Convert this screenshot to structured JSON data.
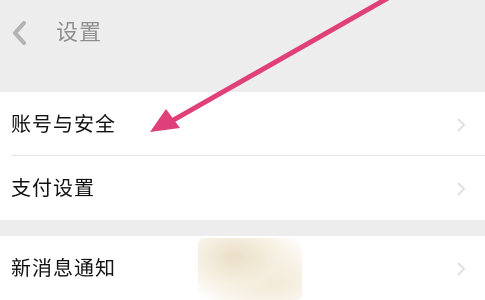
{
  "header": {
    "title": "设置",
    "back_icon": "chevron-left-icon"
  },
  "settings": {
    "items": [
      {
        "label": "账号与安全",
        "icon": "chevron-right-icon"
      },
      {
        "label": "支付设置",
        "icon": "chevron-right-icon"
      },
      {
        "label": "新消息通知",
        "icon": "chevron-right-icon"
      }
    ]
  },
  "annotation": {
    "arrow_color": "#e0407a"
  },
  "colors": {
    "page_background": "#ededed",
    "row_background": "#ffffff",
    "text": "#111111"
  }
}
